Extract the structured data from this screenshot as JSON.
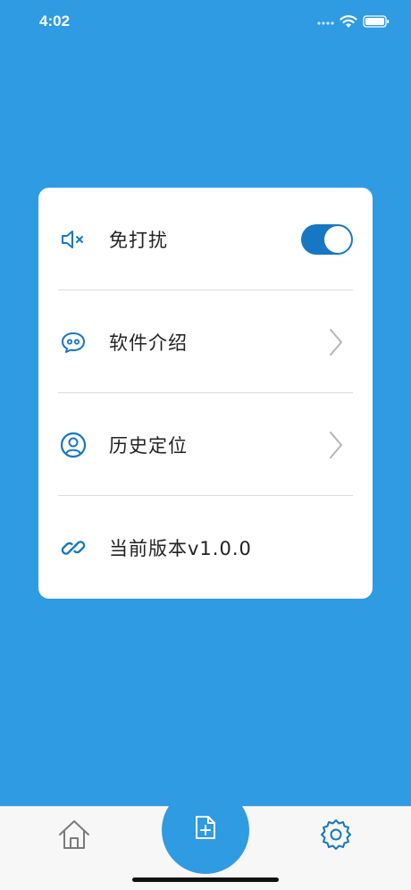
{
  "status_bar": {
    "time": "4:02"
  },
  "settings": {
    "items": [
      {
        "label": "免打扰",
        "icon": "mute-speaker-icon",
        "control": "toggle",
        "toggle_on": true
      },
      {
        "label": "软件介绍",
        "icon": "chat-bubble-icon",
        "control": "chevron"
      },
      {
        "label": "历史定位",
        "icon": "user-circle-icon",
        "control": "chevron"
      },
      {
        "label": "当前版本v1.0.0",
        "icon": "link-icon",
        "control": "none"
      }
    ]
  },
  "tab_bar": {
    "items": [
      {
        "icon": "home-icon"
      },
      {
        "icon": "add-document-icon"
      },
      {
        "icon": "gear-icon"
      }
    ]
  },
  "colors": {
    "background": "#2f9be2",
    "accent": "#1777c3",
    "card": "#ffffff"
  }
}
